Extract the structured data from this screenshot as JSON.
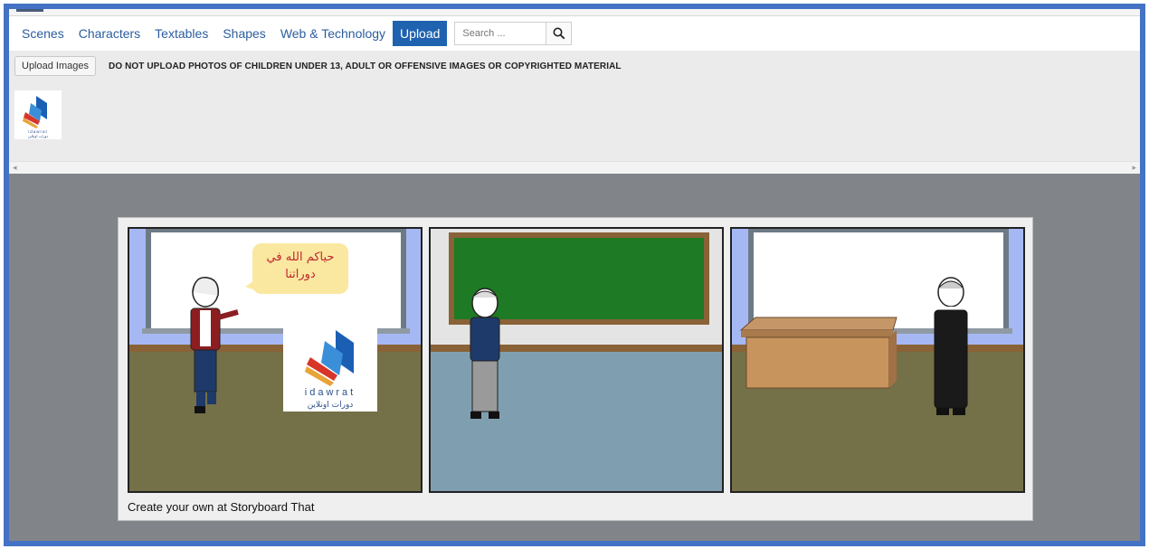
{
  "tabs": [
    {
      "label": "Scenes",
      "active": false
    },
    {
      "label": "Characters",
      "active": false
    },
    {
      "label": "Textables",
      "active": false
    },
    {
      "label": "Shapes",
      "active": false
    },
    {
      "label": "Web & Technology",
      "active": false
    },
    {
      "label": "Upload",
      "active": true
    }
  ],
  "search": {
    "placeholder": "Search ..."
  },
  "upload": {
    "button_label": "Upload Images",
    "warning": "DO NOT UPLOAD PHOTOS OF CHILDREN UNDER 13, ADULT OR OFFENSIVE IMAGES OR COPYRIGHTED MATERIAL"
  },
  "logo": {
    "word": "idawrat",
    "arabic": "دورات اونلاين"
  },
  "storyboard": {
    "speech_bubble": "حياكم الله في دوراتنا",
    "credit": "Create your own at Storyboard That"
  },
  "colors": {
    "accent": "#1f63b0",
    "frame": "#4472c4",
    "canvas": "#818589"
  }
}
